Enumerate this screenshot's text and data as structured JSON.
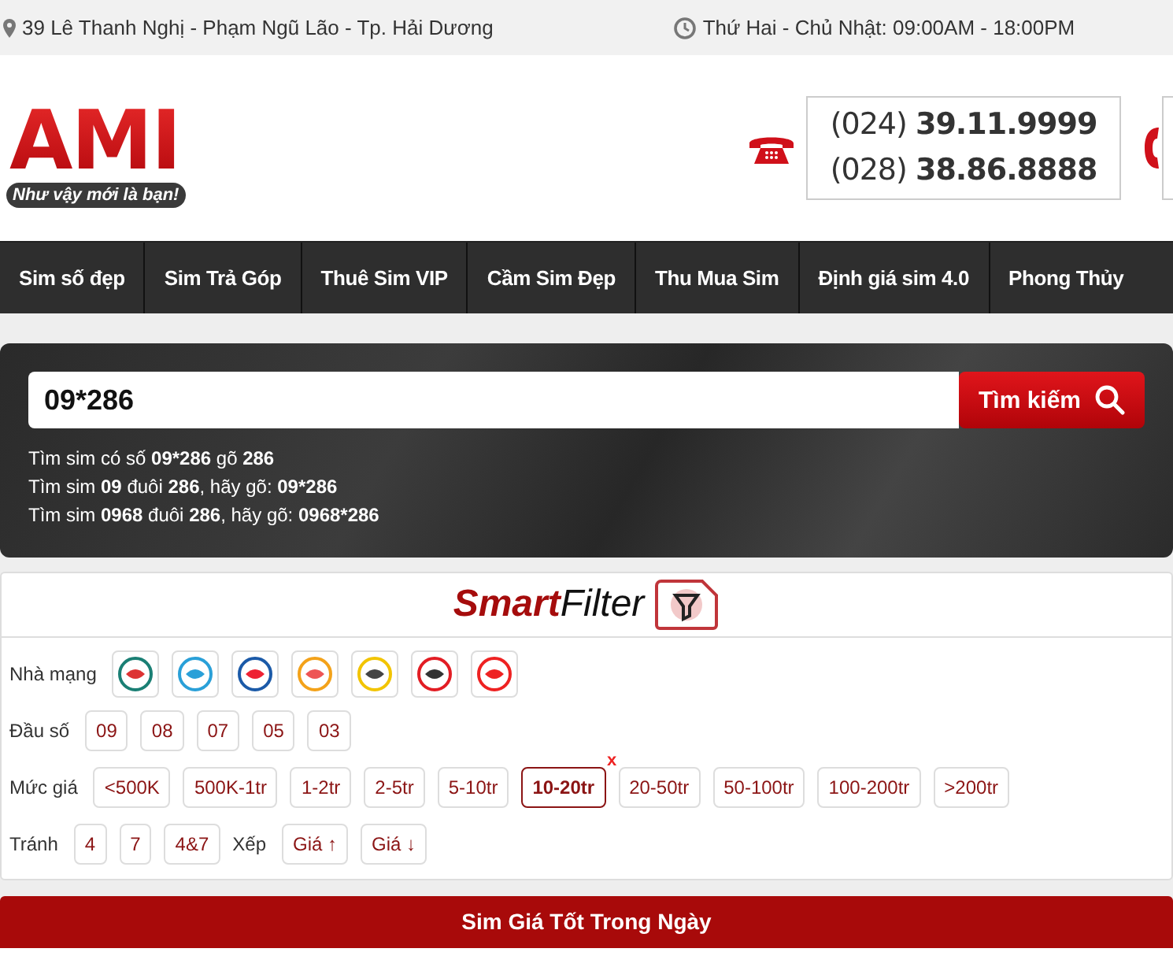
{
  "top_bar": {
    "address": "39 Lê Thanh Nghị - Phạm Ngũ Lão - Tp. Hải Dương",
    "hours": "Thứ Hai - Chủ Nhật: 09:00AM - 18:00PM"
  },
  "logo": {
    "text": "AMI",
    "tagline": "Như vậy mới là bạn!"
  },
  "phones": [
    "(024) **39.11.9999**",
    "(028) **38.86.8888**"
  ],
  "nav": [
    {
      "label": "Sim số đẹp"
    },
    {
      "label": "Sim Trả Góp"
    },
    {
      "label": "Thuê Sim VIP"
    },
    {
      "label": "Cầm Sim Đẹp"
    },
    {
      "label": "Thu Mua Sim"
    },
    {
      "label": "Định giá sim 4.0"
    },
    {
      "label": "Phong Thủy"
    }
  ],
  "search": {
    "value": "09*286",
    "button": "Tìm kiếm",
    "hints": [
      "Tìm sim có số **09*286** gõ **286**",
      "Tìm sim **09** đuôi **286**, hãy gõ: **09*286**",
      "Tìm sim **0968** đuôi **286**, hãy gõ: **0968*286**"
    ]
  },
  "smart_filter": {
    "title_a": "Smart",
    "title_b": "Filter",
    "carrier_label": "Nhà mạng",
    "carriers": [
      {
        "selected": false
      },
      {
        "selected": false
      },
      {
        "selected": false
      },
      {
        "selected": false
      },
      {
        "selected": false
      },
      {
        "selected": false
      },
      {
        "selected": false
      }
    ],
    "prefix_label": "Đầu số",
    "prefixes": [
      {
        "label": "09",
        "selected": false
      },
      {
        "label": "08",
        "selected": false
      },
      {
        "label": "07",
        "selected": false
      },
      {
        "label": "05",
        "selected": false
      },
      {
        "label": "03",
        "selected": false
      }
    ],
    "price_label": "Mức giá",
    "clear_mark": "x",
    "prices": [
      {
        "label": "<500K",
        "selected": false
      },
      {
        "label": "500K-1tr",
        "selected": false
      },
      {
        "label": "1-2tr",
        "selected": false
      },
      {
        "label": "2-5tr",
        "selected": false
      },
      {
        "label": "5-10tr",
        "selected": false
      },
      {
        "label": "10-20tr",
        "selected": true
      },
      {
        "label": "20-50tr",
        "selected": false
      },
      {
        "label": "50-100tr",
        "selected": false
      },
      {
        "label": "100-200tr",
        "selected": false
      },
      {
        "label": ">200tr",
        "selected": false
      }
    ],
    "avoid_label": "Tránh",
    "avoid": [
      {
        "label": "4",
        "selected": false
      },
      {
        "label": "7",
        "selected": false
      },
      {
        "label": "4&7",
        "selected": false
      }
    ],
    "sort_label": "Xếp",
    "sort": [
      {
        "label": "Giá ↑",
        "selected": false
      },
      {
        "label": "Giá ↓",
        "selected": false
      }
    ]
  },
  "section_title": "Sim Giá Tốt Trong Ngày"
}
